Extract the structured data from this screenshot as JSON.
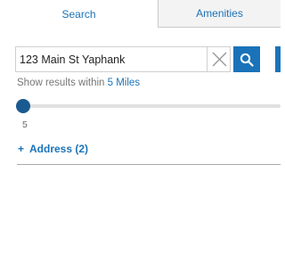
{
  "tabs": [
    {
      "label": "Search",
      "active": true
    },
    {
      "label": "Amenities",
      "active": false
    }
  ],
  "search": {
    "value": "123 Main St Yaphank",
    "placeholder": ""
  },
  "radius": {
    "prefix": "Show results within",
    "value_text": "5 Miles",
    "slider_value": 5,
    "slider_min": 5,
    "tick_label": "5"
  },
  "address_toggle": {
    "symbol": "+",
    "label": "Address (2)"
  },
  "colors": {
    "accent": "#1a73b9",
    "thumb": "#1a5a90"
  },
  "icons": {
    "clear": "close-icon",
    "search": "search-icon"
  }
}
